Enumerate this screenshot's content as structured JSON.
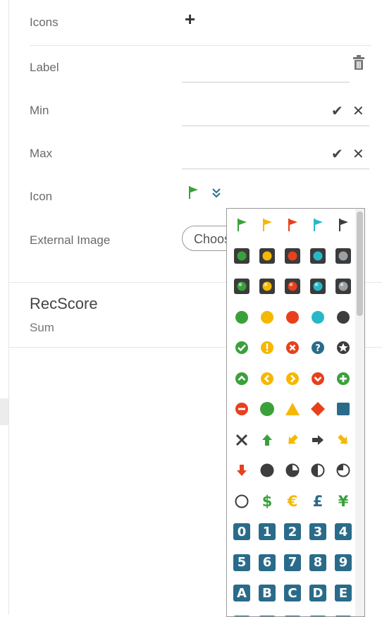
{
  "form": {
    "icons_label": "Icons",
    "label_label": "Label",
    "min_label": "Min",
    "max_label": "Max",
    "icon_label": "Icon",
    "external_image_label": "External Image",
    "choose_button": "Choose"
  },
  "section": {
    "title": "RecScore",
    "subtitle": "Sum"
  },
  "icon_picker": {
    "rows": [
      [
        "flag-green",
        "flag-yellow",
        "flag-red",
        "flag-cyan",
        "flag-dark"
      ],
      [
        "light-green",
        "light-yellow",
        "light-red",
        "light-cyan",
        "light-grey"
      ],
      [
        "orb-green",
        "orb-yellow",
        "orb-red",
        "orb-cyan",
        "orb-grey"
      ],
      [
        "dot-green",
        "dot-yellow",
        "dot-red",
        "dot-cyan",
        "dot-dark"
      ],
      [
        "check-circle",
        "exclaim-circle",
        "x-circle",
        "question-circle",
        "star-circle"
      ],
      [
        "chev-up-circle",
        "chev-left-circle",
        "chev-right-circle",
        "chev-down-circle",
        "plus-circle"
      ],
      [
        "minus-circle-red",
        "circle-green",
        "triangle-yellow",
        "diamond-red",
        "square-teal"
      ],
      [
        "x-mark",
        "arrow-up-green",
        "arrow-downleft-yellow",
        "arrow-right-dark",
        "arrow-downright-yellow"
      ],
      [
        "arrow-down-red",
        "pie-full",
        "pie-three-quarter",
        "pie-half",
        "pie-quarter"
      ],
      [
        "pie-empty",
        "dollar",
        "euro",
        "pound",
        "yen"
      ],
      [
        "0",
        "1",
        "2",
        "3",
        "4"
      ],
      [
        "5",
        "6",
        "7",
        "8",
        "9"
      ],
      [
        "A",
        "B",
        "C",
        "D",
        "E"
      ],
      [
        "F",
        "G",
        "H",
        "I",
        "J"
      ]
    ],
    "currency": {
      "dollar": "$",
      "euro": "€",
      "pound": "£",
      "yen": "¥"
    },
    "colors": {
      "green": "#3aa13a",
      "yellow": "#f5b800",
      "red": "#e8401c",
      "cyan": "#26b8c8",
      "dark": "#3d3d3d",
      "grey": "#9aa0a4",
      "teal": "#2a6b8a",
      "tile": "#3b3b3b"
    }
  }
}
